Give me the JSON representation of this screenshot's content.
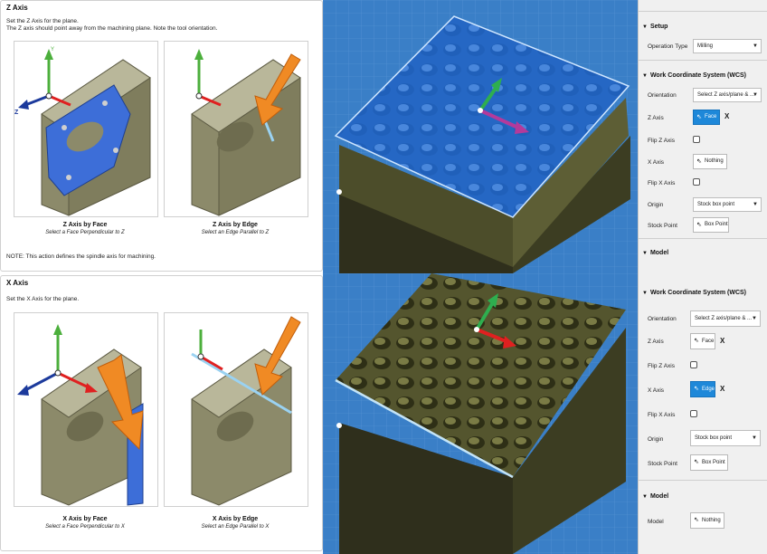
{
  "z_tip": {
    "title": "Z Axis",
    "line1": "Set the Z Axis for the plane.",
    "line2": "The Z axis should point away from the machining plane. Note the tool orientation.",
    "left_caption_title": "Z Axis by Face",
    "left_caption_sub": "Select a Face Perpendicular to Z",
    "right_caption_title": "Z Axis by Edge",
    "right_caption_sub": "Select an Edge Parallel to Z",
    "note": "NOTE: This action defines the spindle axis for machining.",
    "axis_y": "Y",
    "axis_z": "Z"
  },
  "x_tip": {
    "title": "X Axis",
    "line1": "Set the X Axis for the plane.",
    "left_caption_title": "X Axis by Face",
    "left_caption_sub": "Select a Face Perpendicular to X",
    "right_caption_title": "X Axis by Edge",
    "right_caption_sub": "Select an Edge Parallel to X",
    "axis_y": "Y",
    "axis_z": "Z",
    "axis_x": "X"
  },
  "panel_top": {
    "setup_header": "Setup",
    "operation_type_label": "Operation Type",
    "operation_type_value": "Milling",
    "wcs_header": "Work Coordinate System (WCS)",
    "orientation_label": "Orientation",
    "orientation_value": "Select Z axis/plane & ...",
    "z_axis_label": "Z Axis",
    "z_axis_value": "Face",
    "flip_z_label": "Flip Z Axis",
    "x_axis_label": "X Axis",
    "x_axis_value": "Nothing",
    "flip_x_label": "Flip X Axis",
    "origin_label": "Origin",
    "origin_value": "Stock box point",
    "stock_point_label": "Stock Point",
    "stock_point_value": "Box Point",
    "model_header": "Model",
    "clear_x": "X"
  },
  "panel_bot": {
    "wcs_header": "Work Coordinate System (WCS)",
    "orientation_label": "Orientation",
    "orientation_value": "Select Z axis/plane & ...",
    "z_axis_label": "Z Axis",
    "z_axis_value": "Face",
    "flip_z_label": "Flip Z Axis",
    "x_axis_label": "X Axis",
    "x_axis_value": "Edge",
    "flip_x_label": "Flip X Axis",
    "origin_label": "Origin",
    "origin_value": "Stock box point",
    "stock_point_label": "Stock Point",
    "stock_point_value": "Box Point",
    "model_header": "Model",
    "model_label": "Model",
    "model_value": "Nothing",
    "clear_x": "X"
  },
  "icons": {
    "section_toggle": "triangle-down-icon",
    "dropdown": "chevron-down-icon",
    "select_cursor": "pointer-cursor-icon",
    "clear": "close-icon"
  },
  "colors": {
    "active_blue": "#1e88d9",
    "viewport_blue": "#3a7fc7",
    "stock_olive": "#4c4d2a",
    "arrow_orange": "#f08a24"
  }
}
